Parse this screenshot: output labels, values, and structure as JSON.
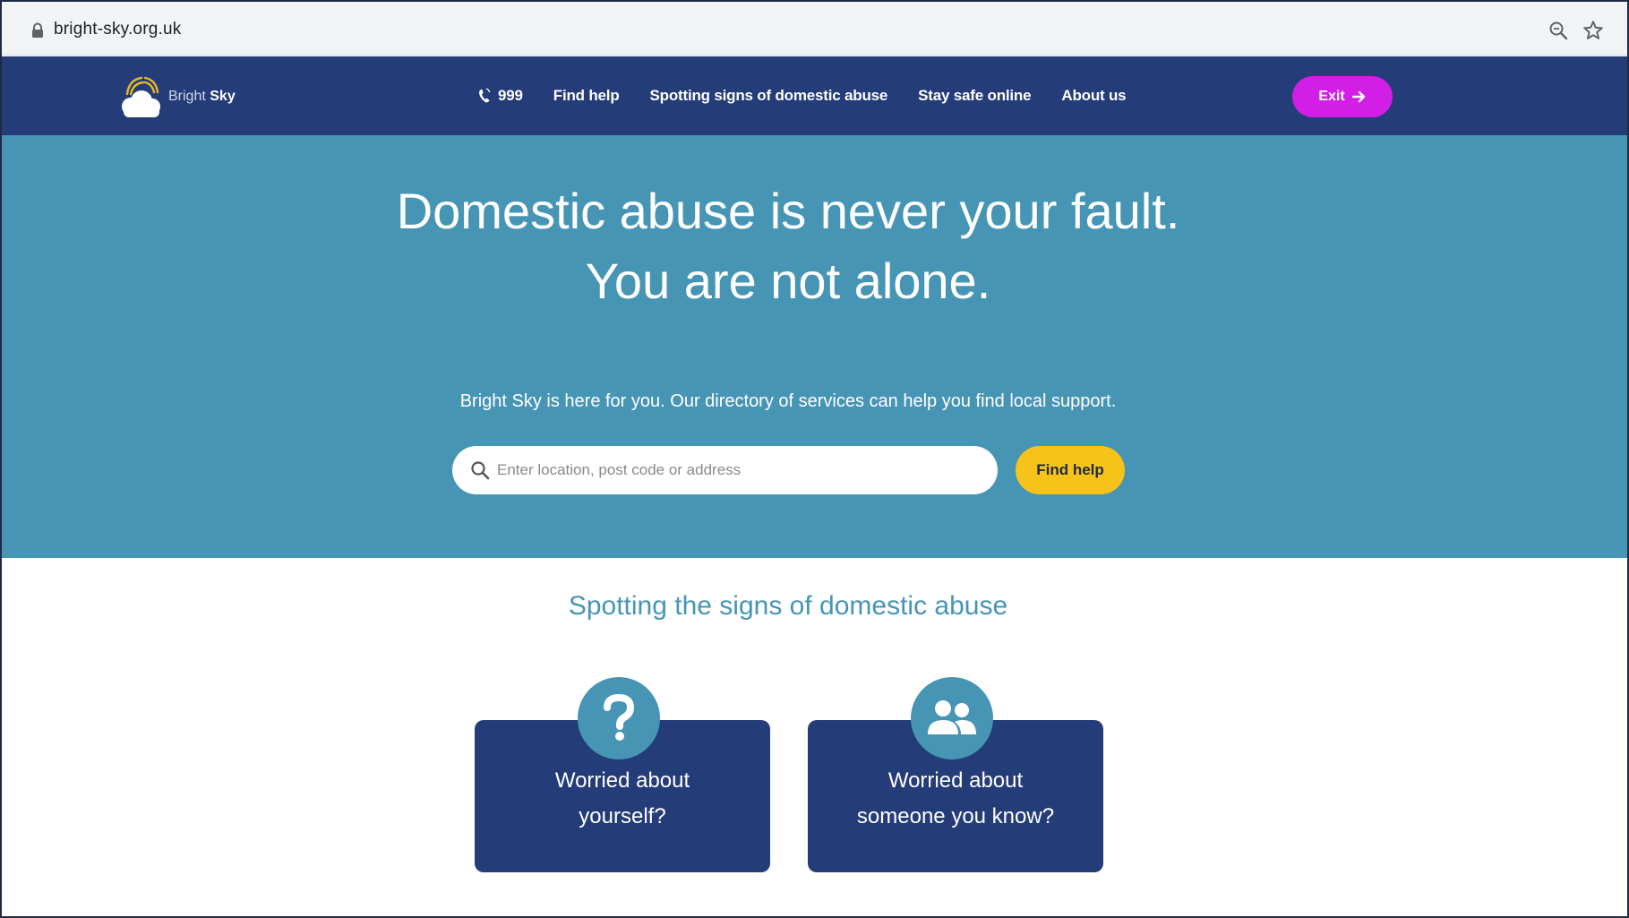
{
  "browser": {
    "url": "bright-sky.org.uk",
    "icons": [
      "lock-icon",
      "zoom-icon",
      "star-icon"
    ]
  },
  "header": {
    "logo_text_light": "Bright",
    "logo_text_bold": "Sky",
    "logo_icon": "sun-cloud-logo",
    "nav": {
      "phone_label": "999",
      "find_help": "Find help",
      "spotting_signs": "Spotting signs of domestic abuse",
      "stay_safe": "Stay safe online",
      "about_us": "About us"
    },
    "exit_label": "Exit",
    "exit_icon": "arrow-right-icon"
  },
  "hero": {
    "title_line1": "Domestic abuse is never your fault.",
    "title_line2": "You are not alone.",
    "intro": "Bright Sky is here for you. Our directory of services can help you find local support.",
    "search_placeholder": "Enter location, post code or address",
    "search_value": "",
    "find_help_button": "Find help"
  },
  "signs": {
    "heading": "Spotting the signs of domestic abuse",
    "cards": [
      {
        "line1": "Worried about",
        "line2": "yourself?",
        "icon": "question-mark-icon"
      },
      {
        "line1": "Worried about",
        "line2": "someone you know?",
        "icon": "people-icon"
      }
    ]
  },
  "colors": {
    "nav_bg": "#243c78",
    "hero_bg": "#4795b5",
    "exit_button": "#d21ee6",
    "find_help_button": "#f7c21a",
    "heading_accent": "#4795b5",
    "card_bg": "#243c78"
  }
}
